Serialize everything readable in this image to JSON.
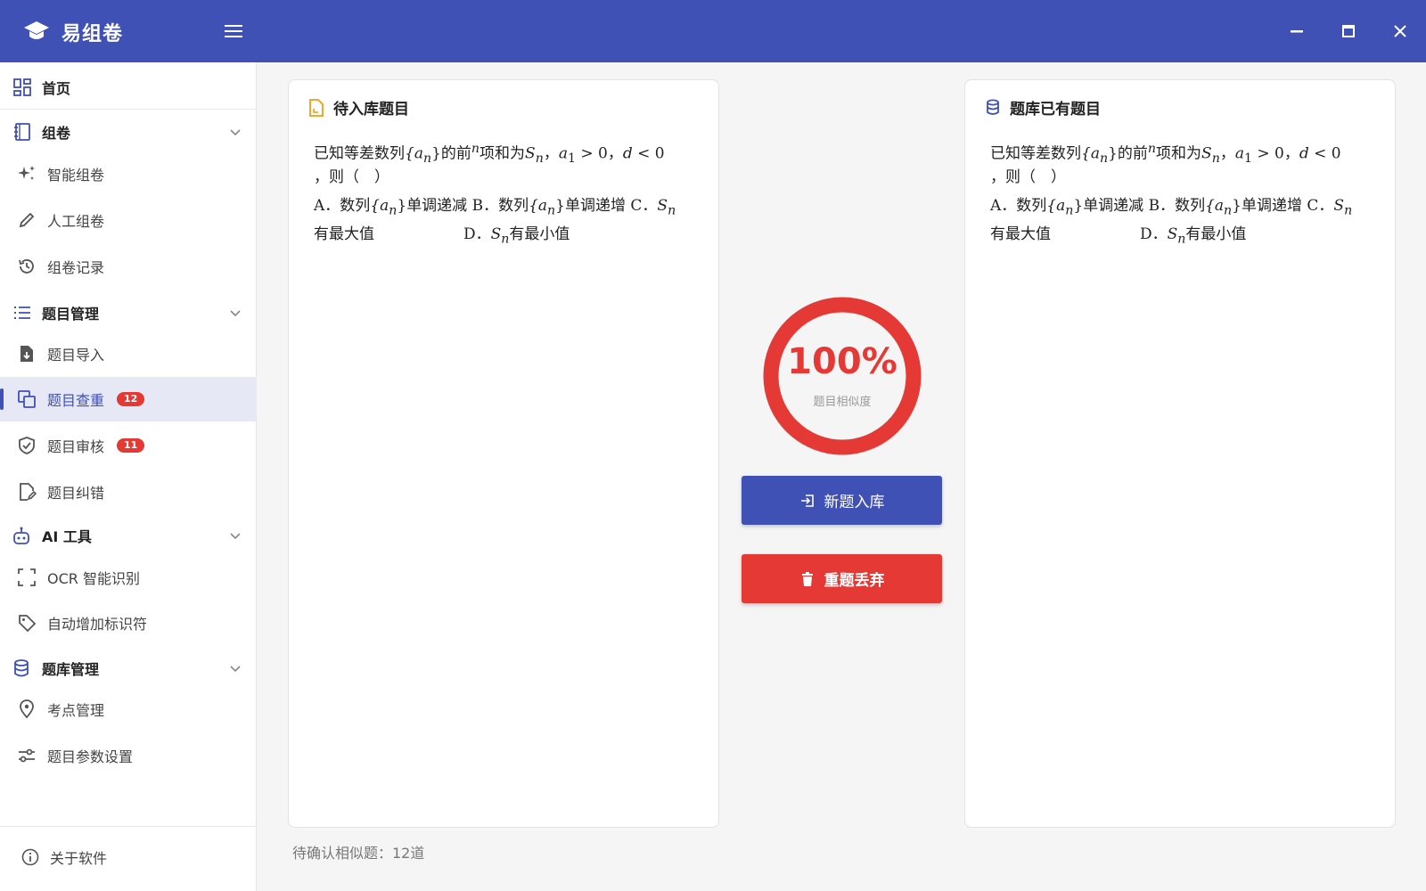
{
  "app": {
    "title": "易组卷"
  },
  "colors": {
    "primary": "#3f51b5",
    "danger": "#e53935"
  },
  "window_controls": {
    "minimize": "minimize-icon",
    "maximize": "maximize-icon",
    "close": "close-icon"
  },
  "sidebar": {
    "home": {
      "label": "首页",
      "icon": "grid-icon"
    },
    "groups": [
      {
        "label": "组卷",
        "icon": "notebook-icon",
        "items": [
          {
            "label": "智能组卷",
            "icon": "sparkle-icon"
          },
          {
            "label": "人工组卷",
            "icon": "pencil-icon"
          },
          {
            "label": "组卷记录",
            "icon": "history-icon"
          }
        ]
      },
      {
        "label": "题目管理",
        "icon": "list-icon",
        "items": [
          {
            "label": "题目导入",
            "icon": "file-import-icon"
          },
          {
            "label": "题目查重",
            "icon": "duplicate-icon",
            "badge": "12",
            "active": true
          },
          {
            "label": "题目审核",
            "icon": "shield-check-icon",
            "badge": "11"
          },
          {
            "label": "题目纠错",
            "icon": "file-edit-icon"
          }
        ]
      },
      {
        "label": "AI 工具",
        "icon": "robot-icon",
        "items": [
          {
            "label": "OCR 智能识别",
            "icon": "scan-icon"
          },
          {
            "label": "自动增加标识符",
            "icon": "tag-icon"
          }
        ]
      },
      {
        "label": "题库管理",
        "icon": "database-icon",
        "items": [
          {
            "label": "考点管理",
            "icon": "location-pin-icon"
          },
          {
            "label": "题目参数设置",
            "icon": "sliders-icon"
          }
        ]
      }
    ],
    "about": {
      "label": "关于软件",
      "icon": "info-icon"
    }
  },
  "pending": {
    "title": "待入库题目",
    "lines": [
      {
        "t1": "已知等差数列",
        "m1": "{a",
        "m1s": "n",
        "m2": "}",
        "t2": "的前",
        "m3": "n",
        "t3": "项和为",
        "m4": "S",
        "m4s": "n",
        "t4": "，",
        "m5": "a",
        "m5s": "1",
        "m6": " > 0，",
        "m7": "d",
        "m8": " < 0"
      },
      {
        "t1": "，则（　）"
      },
      {
        "t1": "A．数列",
        "m1": "{a",
        "m1s": "n",
        "m2": "}",
        "t2": "单调递减  B．数列",
        "m3": "{a",
        "m3s": "n",
        "m4": "}",
        "t3": "单调递增  C．",
        "m5": "S",
        "m5s": "n"
      },
      {
        "t1": "有最大值",
        "t2": "D．",
        "m1": "S",
        "m1s": "n",
        "t3": "有最小值"
      }
    ]
  },
  "existing": {
    "title": "题库已有题目",
    "lines": [
      {
        "t1": "已知等差数列",
        "m1": "{a",
        "m1s": "n",
        "m2": "}",
        "t2": "的前",
        "m3": "n",
        "t3": "项和为",
        "m4": "S",
        "m4s": "n",
        "t4": "，",
        "m5": "a",
        "m5s": "1",
        "m6": " > 0，",
        "m7": "d",
        "m8": " < 0"
      },
      {
        "t1": "，则（　）"
      },
      {
        "t1": "A．数列",
        "m1": "{a",
        "m1s": "n",
        "m2": "}",
        "t2": "单调递减  B．数列",
        "m3": "{a",
        "m3s": "n",
        "m4": "}",
        "t3": "单调递增  C．",
        "m5": "S",
        "m5s": "n"
      },
      {
        "t1": "有最大值",
        "t2": "D．",
        "m1": "S",
        "m1s": "n",
        "t3": "有最小值"
      }
    ]
  },
  "similarity": {
    "value": "100%",
    "fraction": 1.0,
    "label": "题目相似度"
  },
  "actions": {
    "add_label": "新题入库",
    "discard_label": "重题丢弃"
  },
  "status": {
    "pending_text": "待确认相似题：12道"
  }
}
